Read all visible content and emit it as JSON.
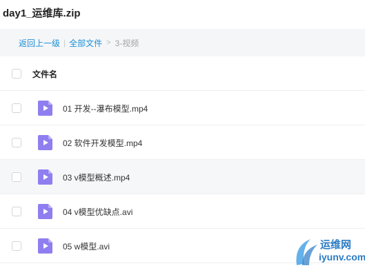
{
  "archive": {
    "title": "day1_运维库.zip"
  },
  "breadcrumb": {
    "back_label": "返回上一级",
    "separator": "|",
    "all_files_label": "全部文件",
    "arrow": ">",
    "current_label": "3-视频"
  },
  "table": {
    "header": {
      "name_label": "文件名"
    },
    "rows": [
      {
        "name": "01 开发--瀑布模型.mp4",
        "icon": "video-file-icon"
      },
      {
        "name": "02 软件开发模型.mp4",
        "icon": "video-file-icon"
      },
      {
        "name": "03 v模型概述.mp4",
        "icon": "video-file-icon"
      },
      {
        "name": "04 v模型优缺点.avi",
        "icon": "video-file-icon"
      },
      {
        "name": "05 w模型.avi",
        "icon": "video-file-icon"
      }
    ]
  },
  "watermark": {
    "line1": "运维网",
    "line2": "iyunv.com"
  },
  "colors": {
    "accent": "#1a8fd6",
    "icon": "#8e7ef0",
    "row_alt": "#f6f7f9"
  }
}
